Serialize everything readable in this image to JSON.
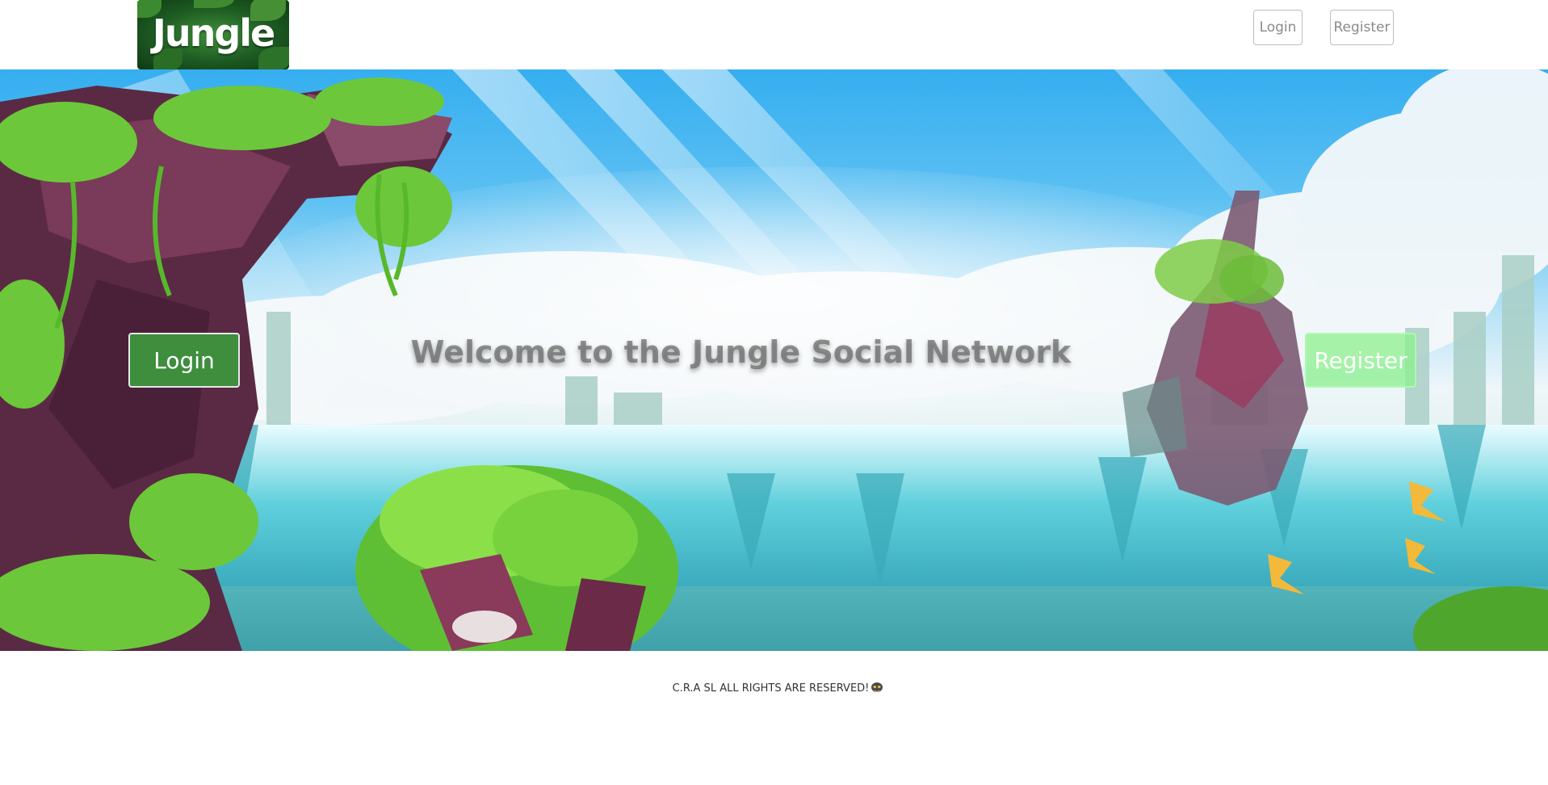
{
  "brand": {
    "logo_text": "Jungle"
  },
  "nav": {
    "login_label": "Login",
    "register_label": "Register"
  },
  "hero": {
    "welcome_text": "Welcome to the Jungle Social Network",
    "login_label": "Login",
    "register_label": "Register"
  },
  "footer": {
    "copyright": "C.R.A SL ALL RIGHTS ARE RESERVED!",
    "icon": "mask-icon"
  },
  "colors": {
    "login_button": "#3e8e3e",
    "register_button": "#8cf08c",
    "sky": "#35aef0",
    "foliage": "#6cc83a",
    "rock": "#5a2a44"
  }
}
